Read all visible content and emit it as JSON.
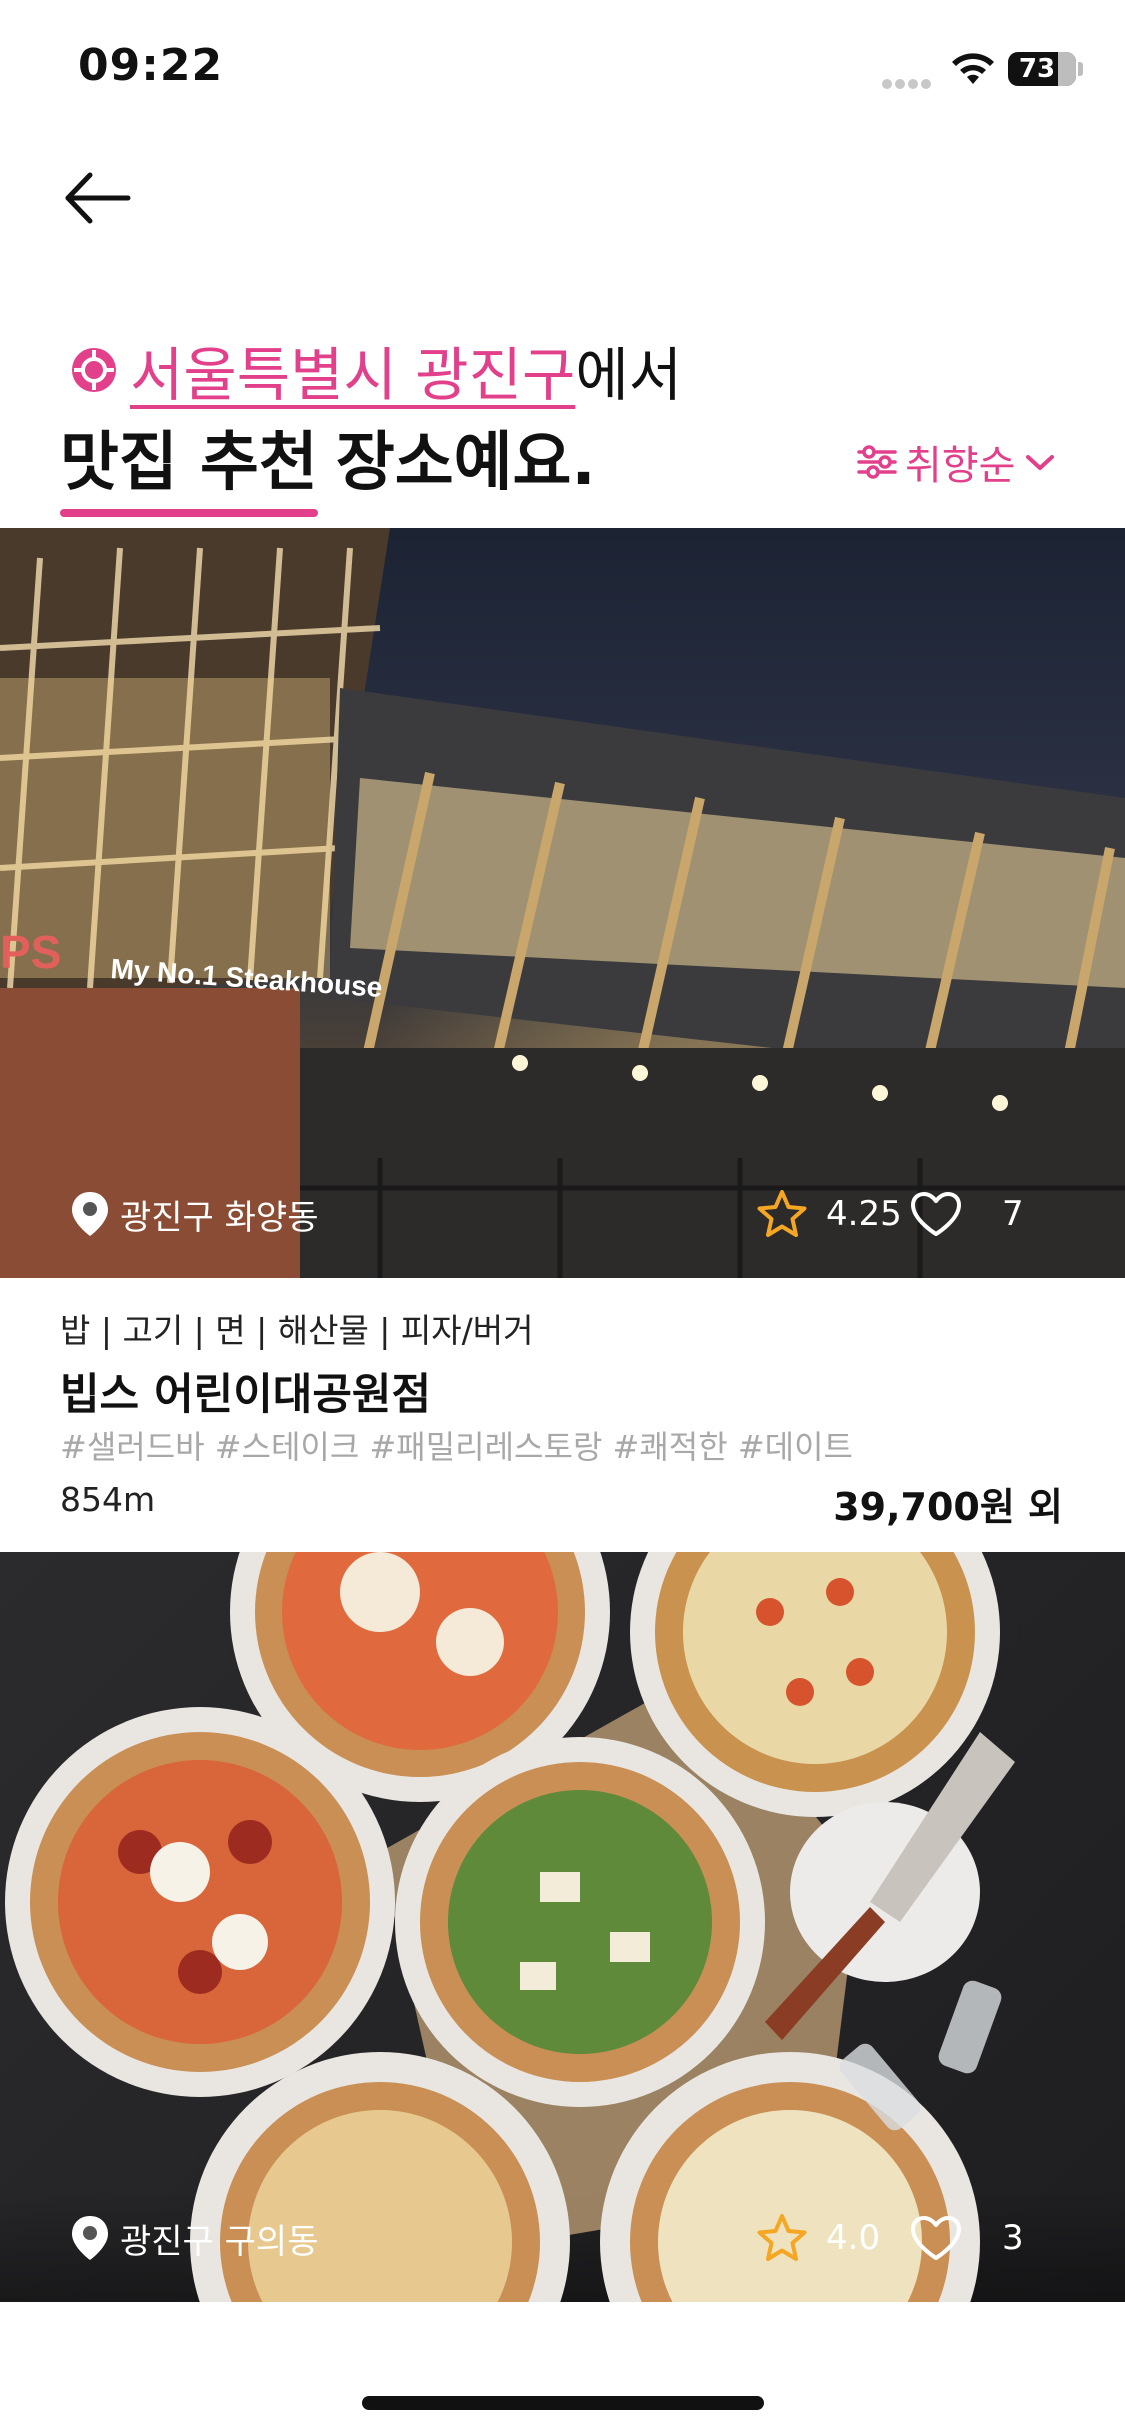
{
  "status_bar": {
    "time": "09:22",
    "battery": "73",
    "battery_level": 0.73,
    "icons": [
      "cellular-signal-icon",
      "wifi-icon",
      "battery-icon"
    ]
  },
  "nav": {
    "back_icon": "arrow-left-icon"
  },
  "heading": {
    "location": "서울특별시 광진구",
    "location_suffix": "에서",
    "highlight": "맛집 추천",
    "rest": "장소예요."
  },
  "sort": {
    "label": "취향순",
    "icon": "sliders-icon"
  },
  "colors": {
    "accent": "#e2408b",
    "star": "#f5a623",
    "tag_gray": "#a8a8a8"
  },
  "restaurants": [
    {
      "location": "광진구 화양동",
      "rating": "4.25",
      "likes": "7",
      "categories": "밥 | 고기 | 면 | 해산물 | 피자/버거",
      "name": "빕스 어린이대공원점",
      "tags": "#샐러드바 #스테이크 #패밀리레스토랑 #쾌적한 #데이트",
      "distance": "854m",
      "price": "39,700원 외",
      "sign_text": "My No.1 Steakhouse"
    },
    {
      "location": "광진구 구의동",
      "rating": "4.0",
      "likes": "3"
    }
  ]
}
